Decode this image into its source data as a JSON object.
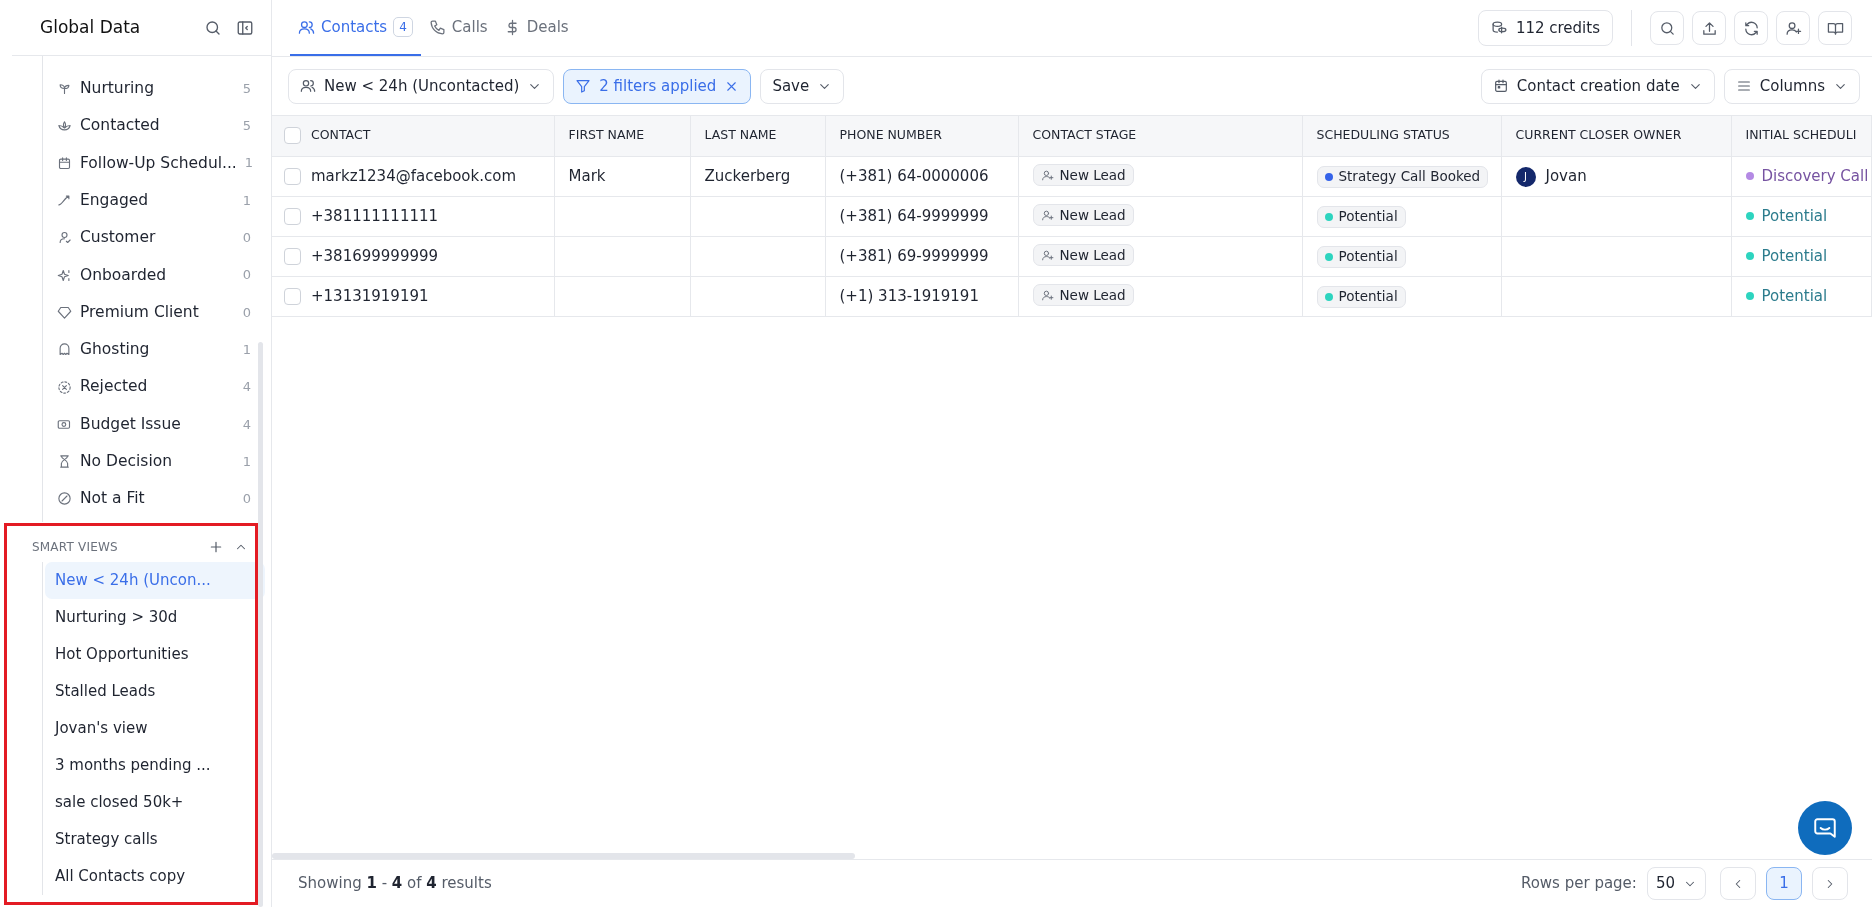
{
  "sidebar": {
    "title": "Global Data",
    "stages": [
      {
        "label": "Nurturing",
        "count": "5"
      },
      {
        "label": "Contacted",
        "count": "5"
      },
      {
        "label": "Follow-Up Schedul...",
        "count": "1"
      },
      {
        "label": "Engaged",
        "count": "1"
      },
      {
        "label": "Customer",
        "count": "0"
      },
      {
        "label": "Onboarded",
        "count": "0"
      },
      {
        "label": "Premium Client",
        "count": "0"
      },
      {
        "label": "Ghosting",
        "count": "1"
      },
      {
        "label": "Rejected",
        "count": "4"
      },
      {
        "label": "Budget Issue",
        "count": "4"
      },
      {
        "label": "No Decision",
        "count": "1"
      },
      {
        "label": "Not a Fit",
        "count": "0"
      }
    ],
    "smart_views": {
      "heading": "SMART VIEWS",
      "expanded": true,
      "items": [
        {
          "label": "New < 24h (Uncon...",
          "selected": true
        },
        {
          "label": "Nurturing > 30d",
          "selected": false
        },
        {
          "label": "Hot Opportunities",
          "selected": false
        },
        {
          "label": "Stalled Leads",
          "selected": false
        },
        {
          "label": "Jovan's view",
          "selected": false
        },
        {
          "label": "3 months pending ...",
          "selected": false
        },
        {
          "label": "sale closed 50k+",
          "selected": false
        },
        {
          "label": "Strategy calls",
          "selected": false
        },
        {
          "label": "All Contacts copy",
          "selected": false
        }
      ]
    }
  },
  "tabs": [
    {
      "label": "Contacts",
      "count": "4",
      "selected": true
    },
    {
      "label": "Calls",
      "selected": false
    },
    {
      "label": "Deals",
      "selected": false
    }
  ],
  "credits": "112 credits",
  "toolbar": {
    "view": "New < 24h (Uncontacted)",
    "filters": "2 filters applied",
    "save": "Save",
    "date_filter": "Contact creation date",
    "columns": "Columns"
  },
  "table": {
    "select_all_checked": false,
    "columns": [
      "CONTACT",
      "FIRST NAME",
      "LAST NAME",
      "PHONE NUMBER",
      "CONTACT STAGE",
      "SCHEDULING STATUS",
      "CURRENT CLOSER OWNER",
      "INITIAL SCHEDULI"
    ],
    "rows": [
      {
        "checked": false,
        "contact": "markz1234@facebook.com",
        "first_name": "Mark",
        "last_name": "Zuckerberg",
        "phone": "(+381) 64-0000006",
        "stage": "New Lead",
        "scheduling_status": {
          "label": "Strategy Call Booked",
          "color": "#3563e9"
        },
        "owner": {
          "initial": "J",
          "name": "Jovan"
        },
        "initial_scheduling": {
          "label": "Discovery Call",
          "color": "#b48ae4"
        }
      },
      {
        "checked": false,
        "contact": "+381111111111",
        "phone": "(+381) 64-9999999",
        "stage": "New Lead",
        "scheduling_status": {
          "label": "Potential",
          "color": "#2dd4bf"
        },
        "initial_scheduling": {
          "label": "Potential",
          "color": "#2dd4bf"
        }
      },
      {
        "checked": false,
        "contact": "+381699999999",
        "phone": "(+381) 69-9999999",
        "stage": "New Lead",
        "scheduling_status": {
          "label": "Potential",
          "color": "#2dd4bf"
        },
        "initial_scheduling": {
          "label": "Potential",
          "color": "#2dd4bf"
        }
      },
      {
        "checked": false,
        "contact": "+13131919191",
        "phone": "(+1) 313-1919191",
        "stage": "New Lead",
        "scheduling_status": {
          "label": "Potential",
          "color": "#2dd4bf"
        },
        "initial_scheduling": {
          "label": "Potential",
          "color": "#2dd4bf"
        }
      }
    ]
  },
  "footer": {
    "summary": "Showing **1** - **4** of **4** results",
    "rows_per_page_label": "Rows per page:",
    "rows_per_page": "50",
    "pages": [
      {
        "label": "1",
        "selected": true
      }
    ]
  }
}
